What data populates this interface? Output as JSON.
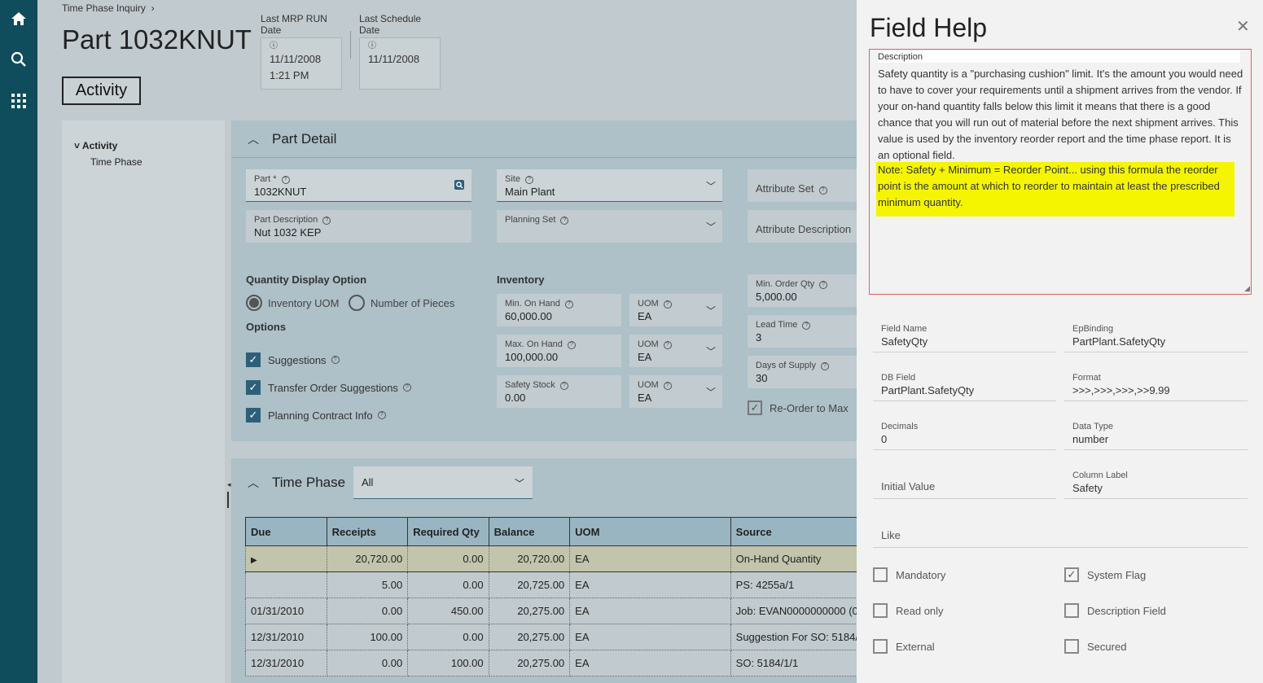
{
  "rail": {
    "home_icon": "home-icon",
    "search_icon": "search-icon",
    "apps_icon": "grid-icon"
  },
  "header": {
    "breadcrumb": "Time Phase Inquiry",
    "title": "Part 1032KNUT",
    "last_mrp_label": "Last MRP RUN Date",
    "last_mrp_date": "11/11/2008",
    "last_mrp_time": "1:21 PM",
    "last_schedule_label": "Last Schedule Date",
    "last_schedule_date": "11/11/2008",
    "activity_button": "Activity"
  },
  "tree": {
    "root": "Activity",
    "child": "Time Phase"
  },
  "part_detail": {
    "title": "Part Detail",
    "part_label": "Part *",
    "part_value": "1032KNUT",
    "site_label": "Site",
    "site_value": "Main Plant",
    "attribute_set_label": "Attribute Set",
    "part_desc_label": "Part Description",
    "part_desc_value": "Nut 1032 KEP",
    "planning_set_label": "Planning Set",
    "attribute_desc_label": "Attribute Description",
    "qty_display_label": "Quantity Display Option",
    "radio_inventory": "Inventory UOM",
    "radio_pieces": "Number of Pieces",
    "options_label": "Options",
    "opt_suggestions": "Suggestions",
    "opt_transfer": "Transfer Order Suggestions",
    "opt_planning": "Planning Contract Info",
    "inventory_label": "Inventory",
    "min_on_hand_label": "Min. On Hand",
    "min_on_hand_value": "60,000.00",
    "max_on_hand_label": "Max. On Hand",
    "max_on_hand_value": "100,000.00",
    "safety_stock_label": "Safety Stock",
    "safety_stock_value": "0.00",
    "uom_label": "UOM",
    "uom_value": "EA",
    "min_order_label": "Min. Order Qty",
    "min_order_value": "5,000.00",
    "lead_time_label": "Lead Time",
    "lead_time_value": "3",
    "days_supply_label": "Days of Supply",
    "days_supply_value": "30",
    "reorder_max_label": "Re-Order to Max"
  },
  "time_phase": {
    "title": "Time Phase",
    "filter_value": "All",
    "columns": [
      "Due",
      "Receipts",
      "Required Qty",
      "Balance",
      "UOM",
      "Source"
    ],
    "rows": [
      {
        "due": "",
        "receipts": "20,720.00",
        "required": "0.00",
        "balance": "20,720.00",
        "uom": "EA",
        "source": "On-Hand Quantity"
      },
      {
        "due": "",
        "receipts": "5.00",
        "required": "0.00",
        "balance": "20,725.00",
        "uom": "EA",
        "source": "PS: 4255a/1"
      },
      {
        "due": "01/31/2010",
        "receipts": "0.00",
        "required": "450.00",
        "balance": "20,275.00",
        "uom": "EA",
        "source": "Job: EVAN0000000000 (0"
      },
      {
        "due": "12/31/2010",
        "receipts": "100.00",
        "required": "0.00",
        "balance": "20,275.00",
        "uom": "EA",
        "source": "Suggestion For SO: 5184/"
      },
      {
        "due": "12/31/2010",
        "receipts": "0.00",
        "required": "100.00",
        "balance": "20,275.00",
        "uom": "EA",
        "source": "SO: 5184/1/1"
      }
    ]
  },
  "field_help": {
    "title": "Field Help",
    "description_label": "Description",
    "description_text": "Safety quantity is a \"purchasing cushion\" limit. It's the amount you would need to have to cover your requirements until a shipment arrives from the vendor. If your on-hand quantity falls below this limit it means that there is a good chance that you will run out of material before the next shipment arrives. This value is used by the inventory reorder report and the time phase report. It is an optional field.",
    "note_text": "Note: Safety + Minimum = Reorder Point...  using this formula the  reorder point is the amount at which to reorder to maintain at least the prescribed minimum quantity.",
    "field_name_label": "Field Name",
    "field_name_value": "SafetyQty",
    "epbinding_label": "EpBinding",
    "epbinding_value": "PartPlant.SafetyQty",
    "db_field_label": "DB Field",
    "db_field_value": "PartPlant.SafetyQty",
    "format_label": "Format",
    "format_value": ">>>,>>>,>>>,>>9.99",
    "decimals_label": "Decimals",
    "decimals_value": "0",
    "data_type_label": "Data Type",
    "data_type_value": "number",
    "initial_value_label": "Initial Value",
    "column_label_label": "Column Label",
    "column_label_value": "Safety",
    "like_label": "Like",
    "mandatory": "Mandatory",
    "system_flag": "System Flag",
    "read_only": "Read only",
    "description_field": "Description Field",
    "external": "External",
    "secured": "Secured"
  }
}
